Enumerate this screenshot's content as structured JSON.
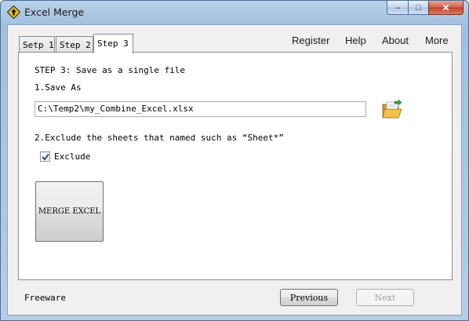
{
  "window": {
    "title": "Excel Merge",
    "minimize_glyph": "–",
    "maximize_glyph": "□",
    "close_glyph": "✕",
    "icon": "excel-merge-app-icon"
  },
  "tabs": [
    {
      "label": "Setp 1",
      "active": false
    },
    {
      "label": "Step 2",
      "active": false
    },
    {
      "label": "Step 3",
      "active": true
    }
  ],
  "menu": {
    "register": "Register",
    "help": "Help",
    "about": "About",
    "more": "More"
  },
  "step3": {
    "title": "STEP 3: Save as a single file",
    "save_as_label": "1.Save As",
    "save_path": "C:\\Temp2\\my_Combine_Excel.xlsx",
    "browse_icon": "open-folder-icon",
    "exclude_label": "2.Exclude the sheets that named such as “Sheet*”",
    "exclude_checkbox_label": "Exclude",
    "exclude_checked": true,
    "merge_button": "MERGE EXCEL"
  },
  "footer": {
    "status": "Freeware",
    "previous_button": "Previous",
    "next_button": "Next",
    "next_enabled": false
  },
  "colors": {
    "title_bar": "#b9d1ea",
    "client_bg": "#f0f0f0",
    "close_button": "#c4412b",
    "folder_icon": "#e8b43a"
  }
}
